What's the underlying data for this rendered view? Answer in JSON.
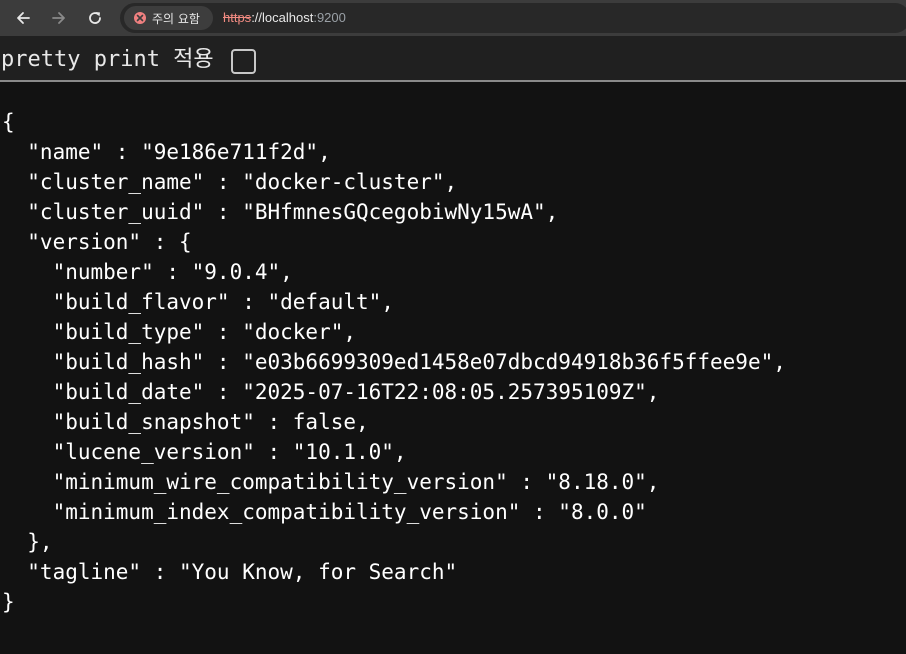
{
  "browser": {
    "security_label": "주의 요함",
    "url_scheme": "https",
    "url_separator": "://",
    "url_host": "localhost",
    "url_port": ":9200"
  },
  "toolbar": {
    "pretty_print_label": "pretty print 적용",
    "pretty_print_checked": false
  },
  "json_lines": [
    "{",
    "  \"name\" : \"9e186e711f2d\",",
    "  \"cluster_name\" : \"docker-cluster\",",
    "  \"cluster_uuid\" : \"BHfmnesGQcegobiwNy15wA\",",
    "  \"version\" : {",
    "    \"number\" : \"9.0.4\",",
    "    \"build_flavor\" : \"default\",",
    "    \"build_type\" : \"docker\",",
    "    \"build_hash\" : \"e03b6699309ed1458e07dbcd94918b36f5ffee9e\",",
    "    \"build_date\" : \"2025-07-16T22:08:05.257395109Z\",",
    "    \"build_snapshot\" : false,",
    "    \"lucene_version\" : \"10.1.0\",",
    "    \"minimum_wire_compatibility_version\" : \"8.18.0\",",
    "    \"minimum_index_compatibility_version\" : \"8.0.0\"",
    "  },",
    "  \"tagline\" : \"You Know, for Search\"",
    "}"
  ],
  "colors": {
    "toolbar_bg": "#3c3c3c",
    "page_bg": "#121212",
    "warning": "#f28b82"
  },
  "icons": [
    "back-arrow-icon",
    "forward-arrow-icon",
    "reload-icon",
    "warning-icon"
  ]
}
